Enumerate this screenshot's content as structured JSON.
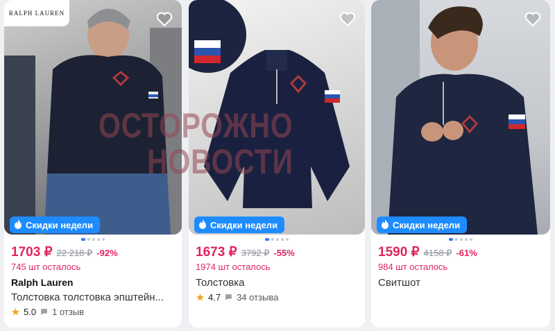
{
  "products": [
    {
      "brand_logo": "RALPH LAUREN",
      "badge": "Скидки недели",
      "price": "1703 ₽",
      "old_price": "22 218 ₽",
      "discount": "-92%",
      "stock": "745 шт осталось",
      "brand": "Ralph Lauren",
      "title": "Толстовка толстовка эпштейн...",
      "rating": "5.0",
      "reviews": "1 отзыв"
    },
    {
      "badge": "Скидки недели",
      "price": "1673 ₽",
      "old_price": "3792 ₽",
      "discount": "-55%",
      "stock": "1974 шт осталось",
      "title": "Толстовка",
      "rating": "4.7",
      "reviews": "34 отзыва"
    },
    {
      "badge": "Скидки недели",
      "price": "1590 ₽",
      "old_price": "4158 ₽",
      "discount": "-61%",
      "stock": "984 шт осталось",
      "title": "Свитшот"
    }
  ],
  "watermark": {
    "line1": "ОСТОРОЖНО",
    "line2": "НОВОСТИ"
  },
  "colors": {
    "price": "#e0245e",
    "badge": "#1e8cff",
    "page_bg": "#eef0f4"
  },
  "icons": [
    "heart-icon",
    "flame-icon",
    "star-icon",
    "comment-icon"
  ]
}
